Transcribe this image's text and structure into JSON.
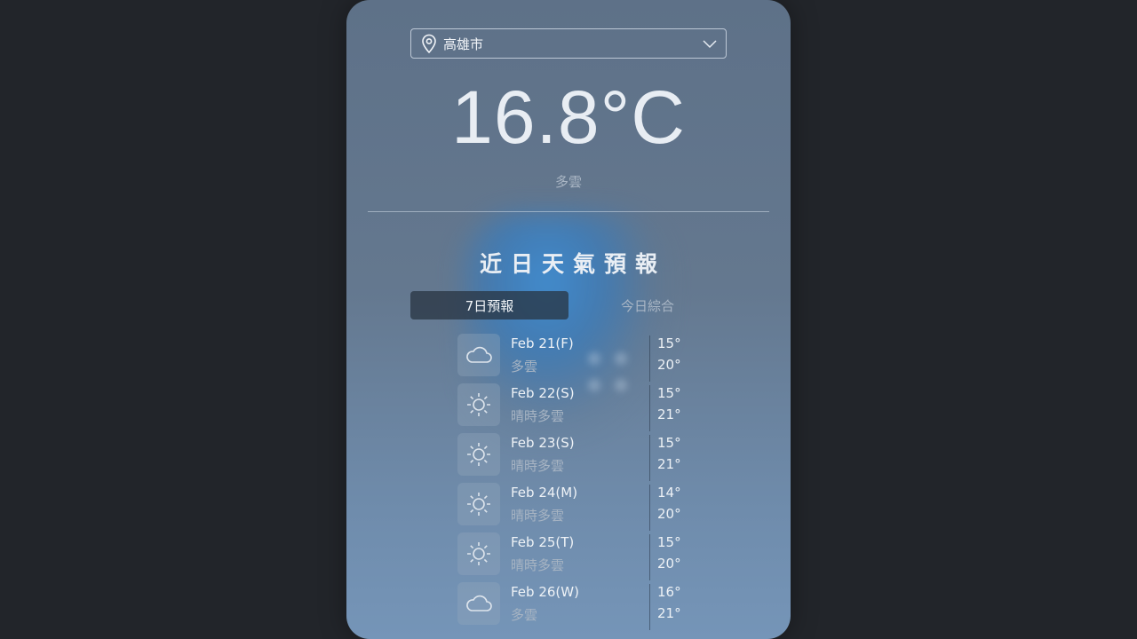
{
  "location": {
    "selected": "高雄市"
  },
  "current": {
    "temperature": "16.8°C",
    "condition": "多雲"
  },
  "section_title": "近日天氣預報",
  "tabs": [
    {
      "label": "7日預報",
      "active": true
    },
    {
      "label": "今日綜合",
      "active": false
    }
  ],
  "forecast": [
    {
      "date": "Feb 21(F)",
      "desc": "多雲",
      "low": "15°",
      "high": "20°",
      "icon": "cloud-icon"
    },
    {
      "date": "Feb 22(S)",
      "desc": "晴時多雲",
      "low": "15°",
      "high": "21°",
      "icon": "sun-icon"
    },
    {
      "date": "Feb 23(S)",
      "desc": "晴時多雲",
      "low": "15°",
      "high": "21°",
      "icon": "sun-icon"
    },
    {
      "date": "Feb 24(M)",
      "desc": "晴時多雲",
      "low": "14°",
      "high": "20°",
      "icon": "sun-icon"
    },
    {
      "date": "Feb 25(T)",
      "desc": "晴時多雲",
      "low": "15°",
      "high": "20°",
      "icon": "sun-icon"
    },
    {
      "date": "Feb 26(W)",
      "desc": "多雲",
      "low": "16°",
      "high": "21°",
      "icon": "cloud-icon"
    }
  ]
}
